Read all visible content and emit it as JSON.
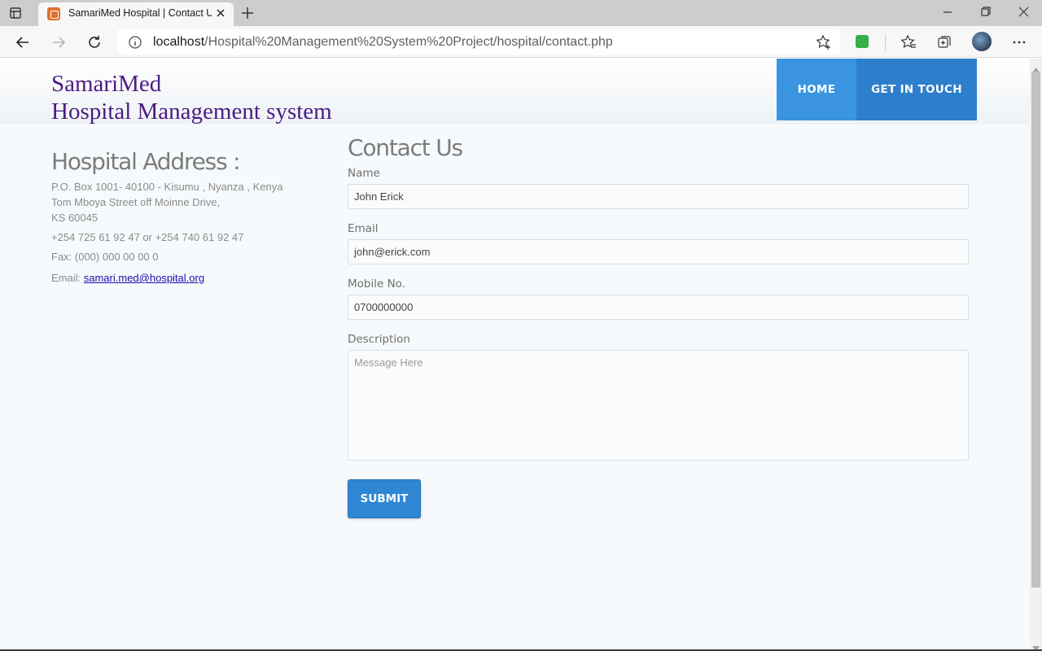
{
  "browser": {
    "tab_title": "SamariMed Hospital | Contact Us",
    "url_host": "localhost",
    "url_path": "/Hospital%20Management%20System%20Project/hospital/contact.php"
  },
  "site": {
    "brand_line1": "SamariMed",
    "brand_line2": "Hospital Management system",
    "nav": {
      "home": "HOME",
      "get_in_touch": "GET IN TOUCH"
    }
  },
  "address": {
    "heading": "Hospital Address :",
    "line1": "P.O. Box 1001- 40100 - Kisumu , Nyanza , Kenya",
    "line2": "Tom Mboya Street off Moinne Drive,",
    "line3": "KS 60045",
    "phone": "+254 725 61 92 47 or +254 740 61 92 47",
    "fax": "Fax: (000) 000 00 00 0",
    "email_label": "Email:",
    "email": "samari.med@hospital.org"
  },
  "contact": {
    "heading": "Contact Us",
    "name_label": "Name",
    "name_value": "John Erick",
    "email_label": "Email",
    "email_value": "john@erick.com",
    "mobile_label": "Mobile No.",
    "mobile_value": "0700000000",
    "description_label": "Description",
    "description_placeholder": "Message Here",
    "submit_label": "SUBMIT"
  },
  "colors": {
    "brand": "#4b1d83",
    "nav_home": "#3a94e0",
    "nav_active": "#2e7fcb",
    "submit": "#2f86d3"
  }
}
